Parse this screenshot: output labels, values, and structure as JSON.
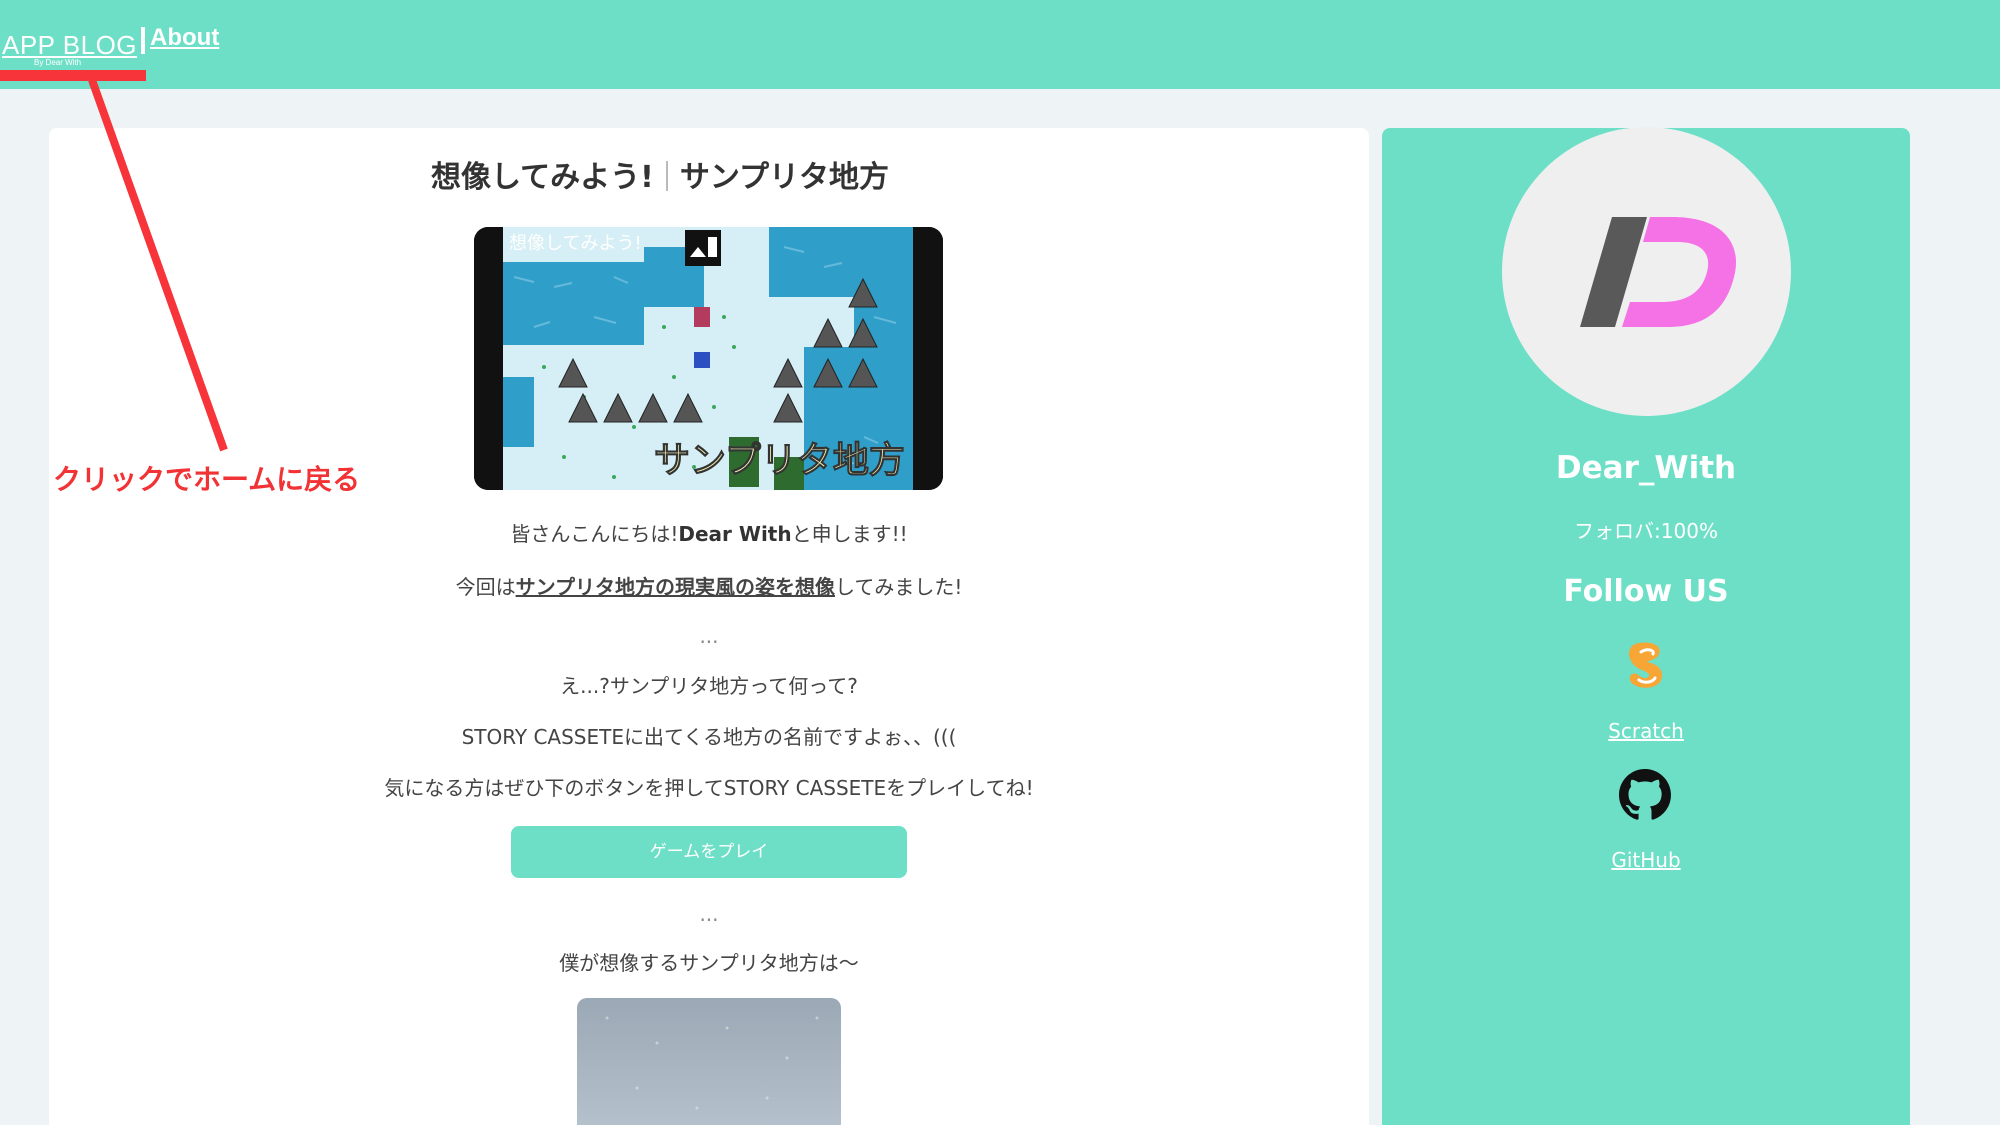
{
  "header": {
    "brand": "APP BLOG",
    "brand_sub": "By Dear With",
    "about": "About"
  },
  "annotation": {
    "callout": "クリックでホームに戻る",
    "color": "#f23336"
  },
  "post": {
    "title_left": "想像してみよう!",
    "title_right": "サンプリタ地方",
    "game_image": {
      "overlay_top": "想像してみよう!",
      "overlay_bottom": "サンプリタ地方"
    },
    "p1_prefix": "皆さんこんにちは!",
    "p1_name": "Dear With",
    "p1_suffix": "と申します!!",
    "p2_prefix": "今回は",
    "p2_emphasis": "サンプリタ地方の現実風の姿を想像",
    "p2_suffix": "してみました!",
    "ellipsis1": "...",
    "p3": "え...?サンプリタ地方って何って?",
    "p4": "STORY CASSETEに出てくる地方の名前ですよぉ、、(((",
    "p5": "気になる方はぜひ下のボタンを押してSTORY CASSETEをプレイしてね!",
    "play_button": "ゲームをプレイ",
    "ellipsis2": "...",
    "p6": "僕が想像するサンプリタ地方は〜"
  },
  "sidebar": {
    "author": "Dear_With",
    "follow_rate": "フォロバ:100%",
    "follow_us": "Follow US",
    "links": [
      {
        "label": "Scratch",
        "icon": "scratch-icon"
      },
      {
        "label": "GitHub",
        "icon": "github-icon"
      }
    ]
  },
  "colors": {
    "accent": "#6ddfc6",
    "highlight": "#f6343a",
    "logo_pink": "#f472e6",
    "logo_gray": "#595959"
  }
}
